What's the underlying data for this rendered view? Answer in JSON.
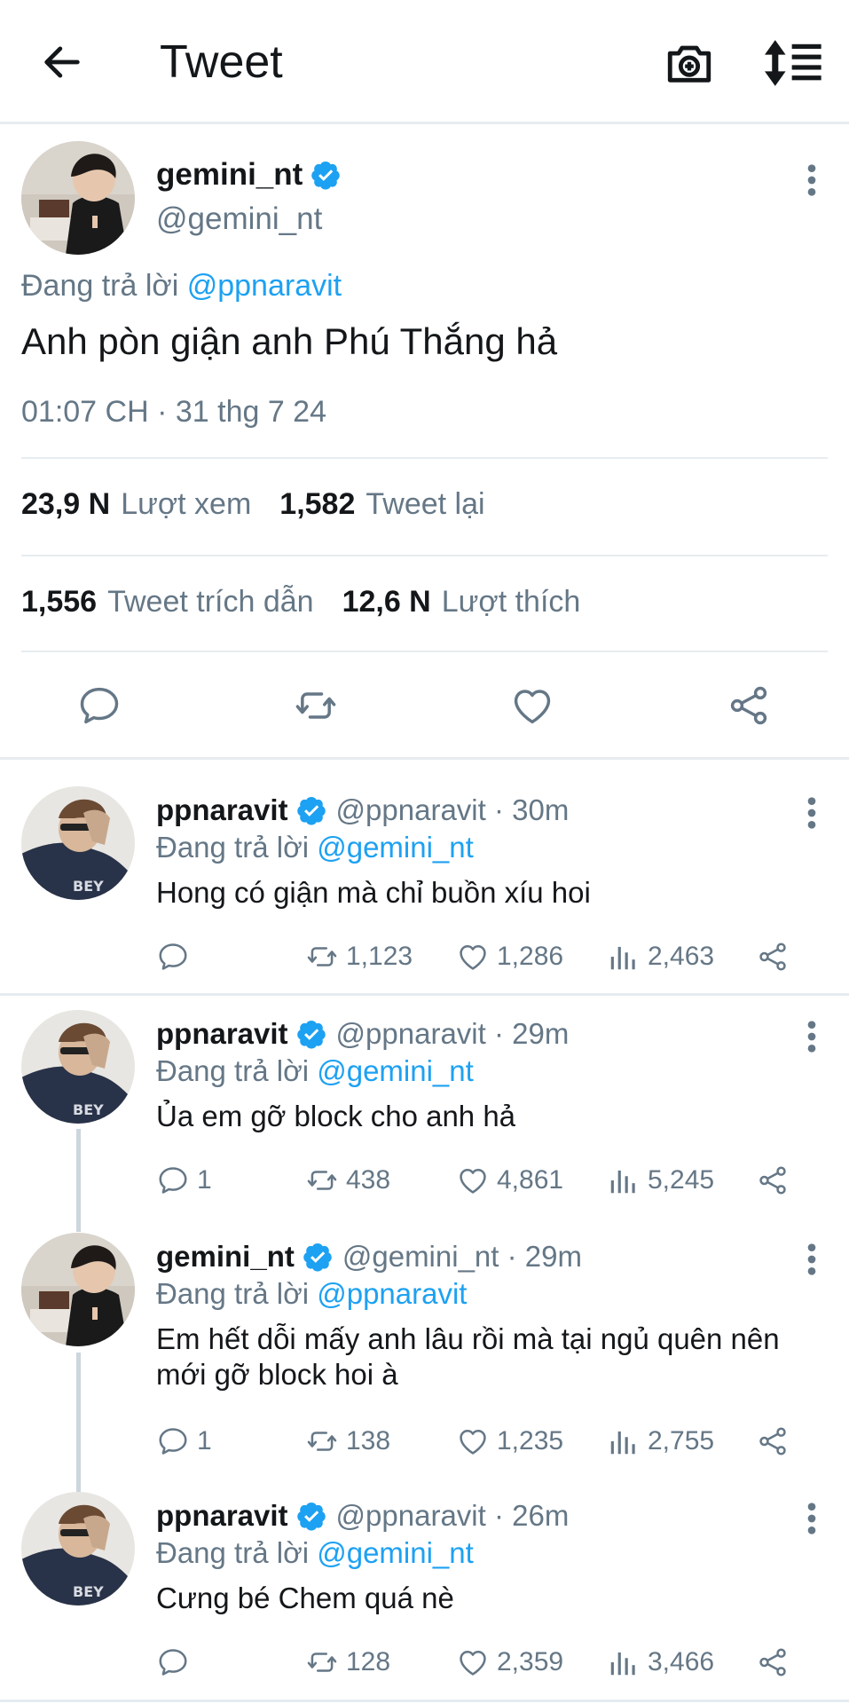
{
  "header": {
    "title": "Tweet",
    "back_icon": "arrow-left-icon",
    "camera_icon": "camera-plus-icon",
    "sort_icon": "sort-list-icon"
  },
  "colors": {
    "link": "#1da1f2",
    "verified": "#1da1f2",
    "muted": "#657786",
    "text": "#14171a"
  },
  "main_tweet": {
    "name": "gemini_nt",
    "handle": "@gemini_nt",
    "reply_prefix": "Đang trả lời",
    "reply_to": "@ppnaravit",
    "text": "Anh pòn giận anh Phú Thắng hả",
    "timestamp": "01:07 CH · 31 thg 7 24",
    "stats": {
      "views_value": "23,9 N",
      "views_label": "Lượt xem",
      "retweets_value": "1,582",
      "retweets_label": "Tweet lại",
      "quotes_value": "1,556",
      "quotes_label": "Tweet trích dẫn",
      "likes_value": "12,6 N",
      "likes_label": "Lượt thích"
    }
  },
  "replies": [
    {
      "name": "ppnaravit",
      "handle": "@ppnaravit · 30m",
      "reply_prefix": "Đang trả lời",
      "reply_to": "@gemini_nt",
      "text": "Hong có giận mà chỉ buồn xíu hoi",
      "replies": "",
      "retweets": "1,123",
      "likes": "1,286",
      "views": "2,463"
    },
    {
      "name": "ppnaravit",
      "handle": "@ppnaravit · 29m",
      "reply_prefix": "Đang trả lời",
      "reply_to": "@gemini_nt",
      "text": "Ủa em gỡ block cho anh hả",
      "replies": "1",
      "retweets": "438",
      "likes": "4,861",
      "views": "5,245"
    },
    {
      "name": "gemini_nt",
      "handle": "@gemini_nt · 29m",
      "reply_prefix": "Đang trả lời",
      "reply_to": "@ppnaravit",
      "text": "Em hết dỗi mấy anh lâu rồi mà tại ngủ quên nên mới gỡ block hoi à",
      "replies": "1",
      "retweets": "138",
      "likes": "1,235",
      "views": "2,755"
    },
    {
      "name": "ppnaravit",
      "handle": "@ppnaravit · 26m",
      "reply_prefix": "Đang trả lời",
      "reply_to": "@gemini_nt",
      "text": "Cưng bé Chem quá nè",
      "replies": "",
      "retweets": "128",
      "likes": "2,359",
      "views": "3,466"
    }
  ]
}
